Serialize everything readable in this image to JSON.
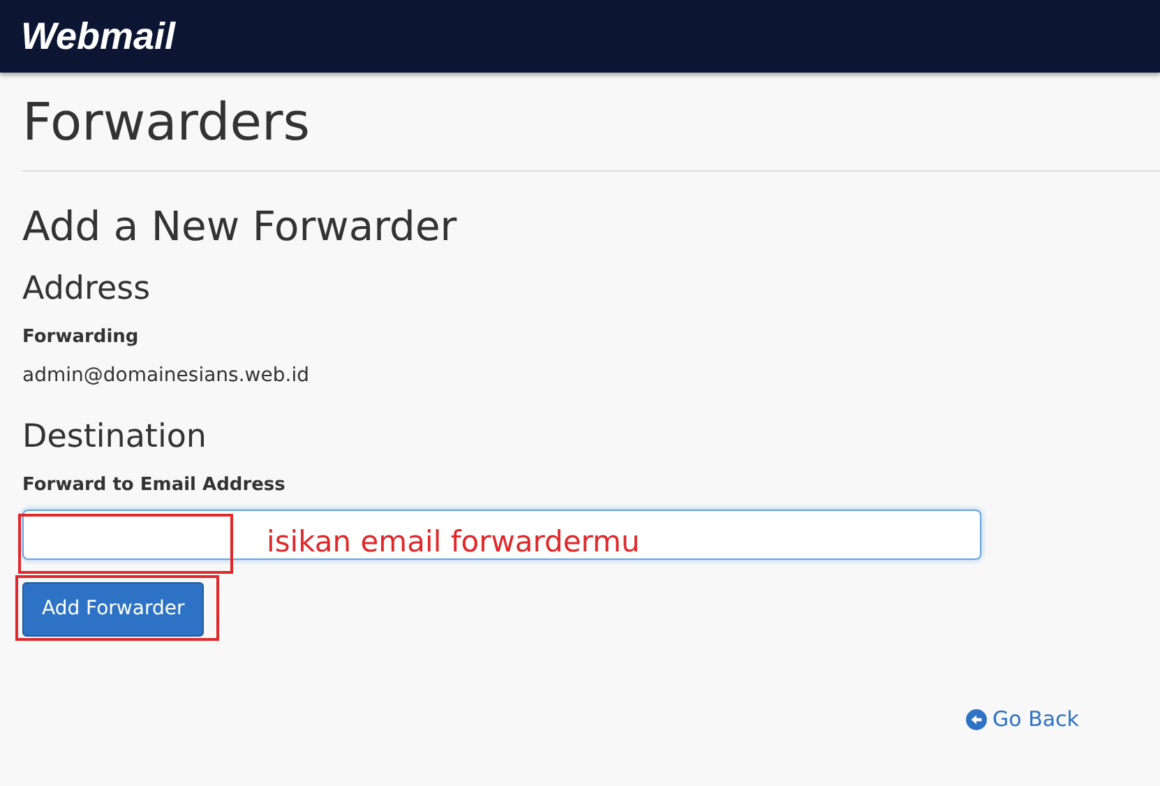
{
  "header": {
    "logo": "Webmail"
  },
  "page_title": "Forwarders",
  "section_title": "Add a New Forwarder",
  "address": {
    "heading": "Address",
    "label": "Forwarding",
    "value": "admin@domainesians.web.id"
  },
  "destination": {
    "heading": "Destination",
    "label": "Forward to Email Address",
    "focused": true
  },
  "submit_button": "Add Forwarder",
  "annotation": {
    "text": "isikan email forwardermu"
  },
  "back_link": "Go Back"
}
